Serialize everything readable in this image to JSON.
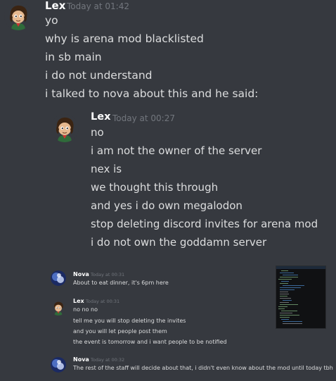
{
  "messages": {
    "m1": {
      "author": "Lex",
      "timestamp": "Today at 01:42",
      "lines": [
        "yo",
        "why is arena mod blacklisted",
        "in sb main",
        "i do not understand",
        "i talked to nova about this and he said:"
      ]
    },
    "quote": {
      "author": "Lex",
      "timestamp": "Today at 00:27",
      "lines": [
        "no",
        "i am not the owner of the server",
        "nex is",
        "we thought this through",
        "and yes i do own megalodon",
        "stop deleting discord invites for arena mod",
        "i do not own the goddamn server"
      ]
    },
    "n1": {
      "author": "Nova",
      "timestamp": "Today at 00:31",
      "lines": [
        "About to eat dinner, it's 6pm here"
      ]
    },
    "l2": {
      "author": "Lex",
      "timestamp": "Today at 00:31",
      "lines": [
        "no no no",
        "tell me you will stop deleting the invites",
        "and you will let people post them",
        "the event is tomorrow and i want people to be notified"
      ]
    },
    "n2": {
      "author": "Nova",
      "timestamp": "Today at 00:32",
      "lines": [
        "The rest of the staff will decide about that, i didn't even know about the mod until today tbh"
      ]
    }
  },
  "colors": {
    "background": "#36393f",
    "text": "#dcddde",
    "username": "#ffffff",
    "timestamp": "#72767d"
  },
  "icons": {
    "lex_avatar": "cartoon-character-avatar",
    "nova_avatar": "blue-abstract-avatar",
    "attachment": "code-editor-screenshot-thumbnail"
  }
}
